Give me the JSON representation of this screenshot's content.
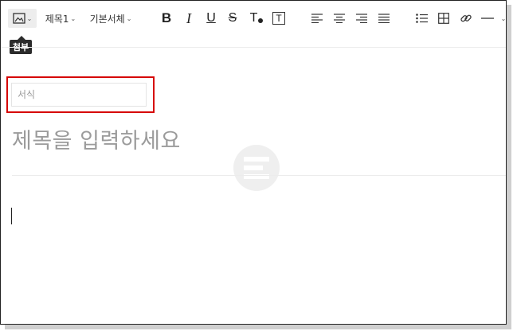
{
  "toolbar": {
    "attach_icon": "image-icon",
    "heading_label": "제목1",
    "font_label": "기본서체",
    "bold_glyph": "B",
    "italic_glyph": "I",
    "underline_glyph": "U",
    "strike_glyph": "S",
    "text_color_glyph": "T",
    "text_bg_glyph": "T",
    "align_icons": [
      "align-left-icon",
      "align-center-icon",
      "align-right-icon",
      "align-justify-icon"
    ],
    "list_icon": "bullet-list-icon",
    "table_icon": "table-icon",
    "link_icon": "link-icon",
    "hr_icon": "horizontal-rule-icon"
  },
  "tooltip": {
    "label": "첨부"
  },
  "editor": {
    "style_field_placeholder": "서식",
    "title_placeholder": "제목을 입력하세요"
  },
  "colors": {
    "highlight": "#d60000",
    "placeholder": "#9b9b9b",
    "tooltip_bg": "#2b2b2b"
  }
}
